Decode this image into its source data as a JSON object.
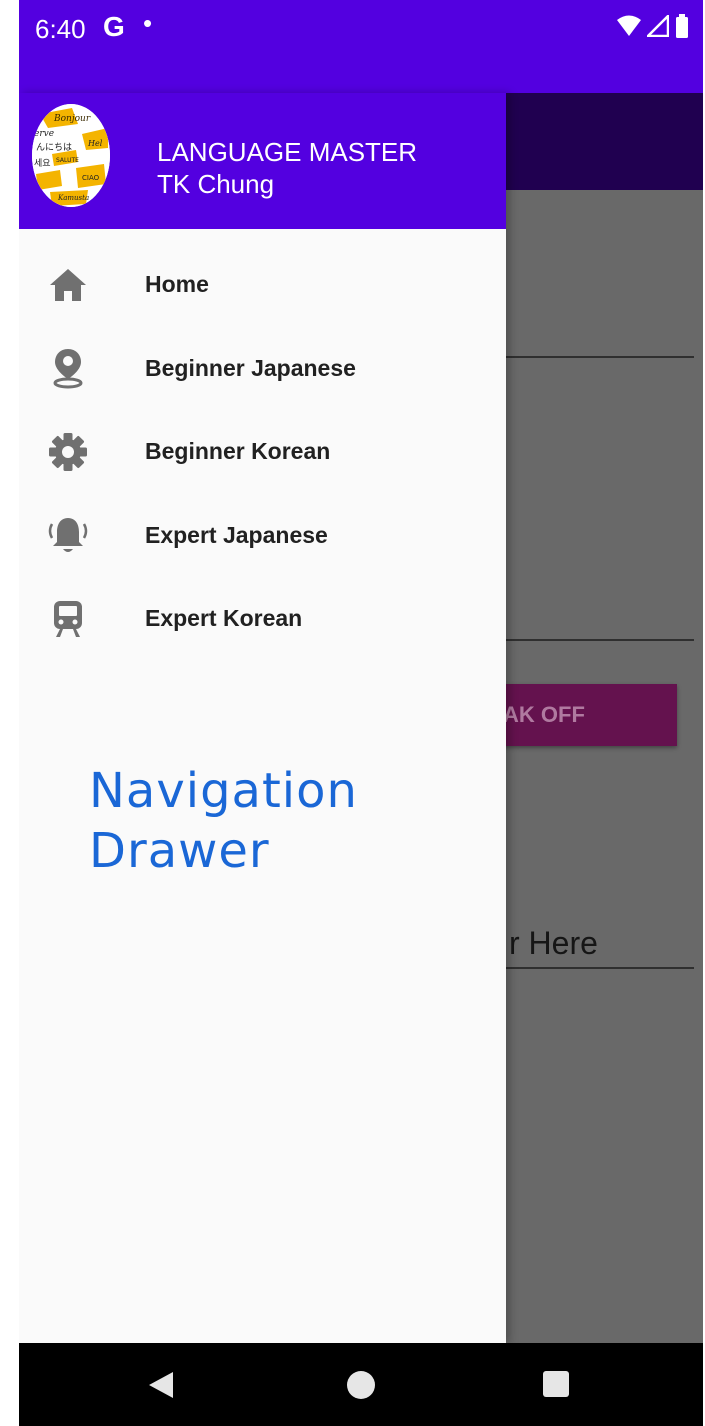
{
  "status_bar": {
    "time": "6:40",
    "google_glyph": "G",
    "notification_dot": "•"
  },
  "background_app": {
    "button_label": "AK OFF",
    "input_text": "r Here"
  },
  "drawer": {
    "header": {
      "title": "LANGUAGE MASTER",
      "subtitle": "TK Chung",
      "color": "#5300e0"
    },
    "items": [
      {
        "label": "Home",
        "icon": "home-icon"
      },
      {
        "label": "Beginner Japanese",
        "icon": "location-pin-icon"
      },
      {
        "label": "Beginner Korean",
        "icon": "gear-icon"
      },
      {
        "label": "Expert Japanese",
        "icon": "bell-ringing-icon"
      },
      {
        "label": "Expert Korean",
        "icon": "train-icon"
      }
    ]
  },
  "annotation": {
    "line1": "Navigation",
    "line2": "Drawer",
    "color": "#1a67d6"
  }
}
